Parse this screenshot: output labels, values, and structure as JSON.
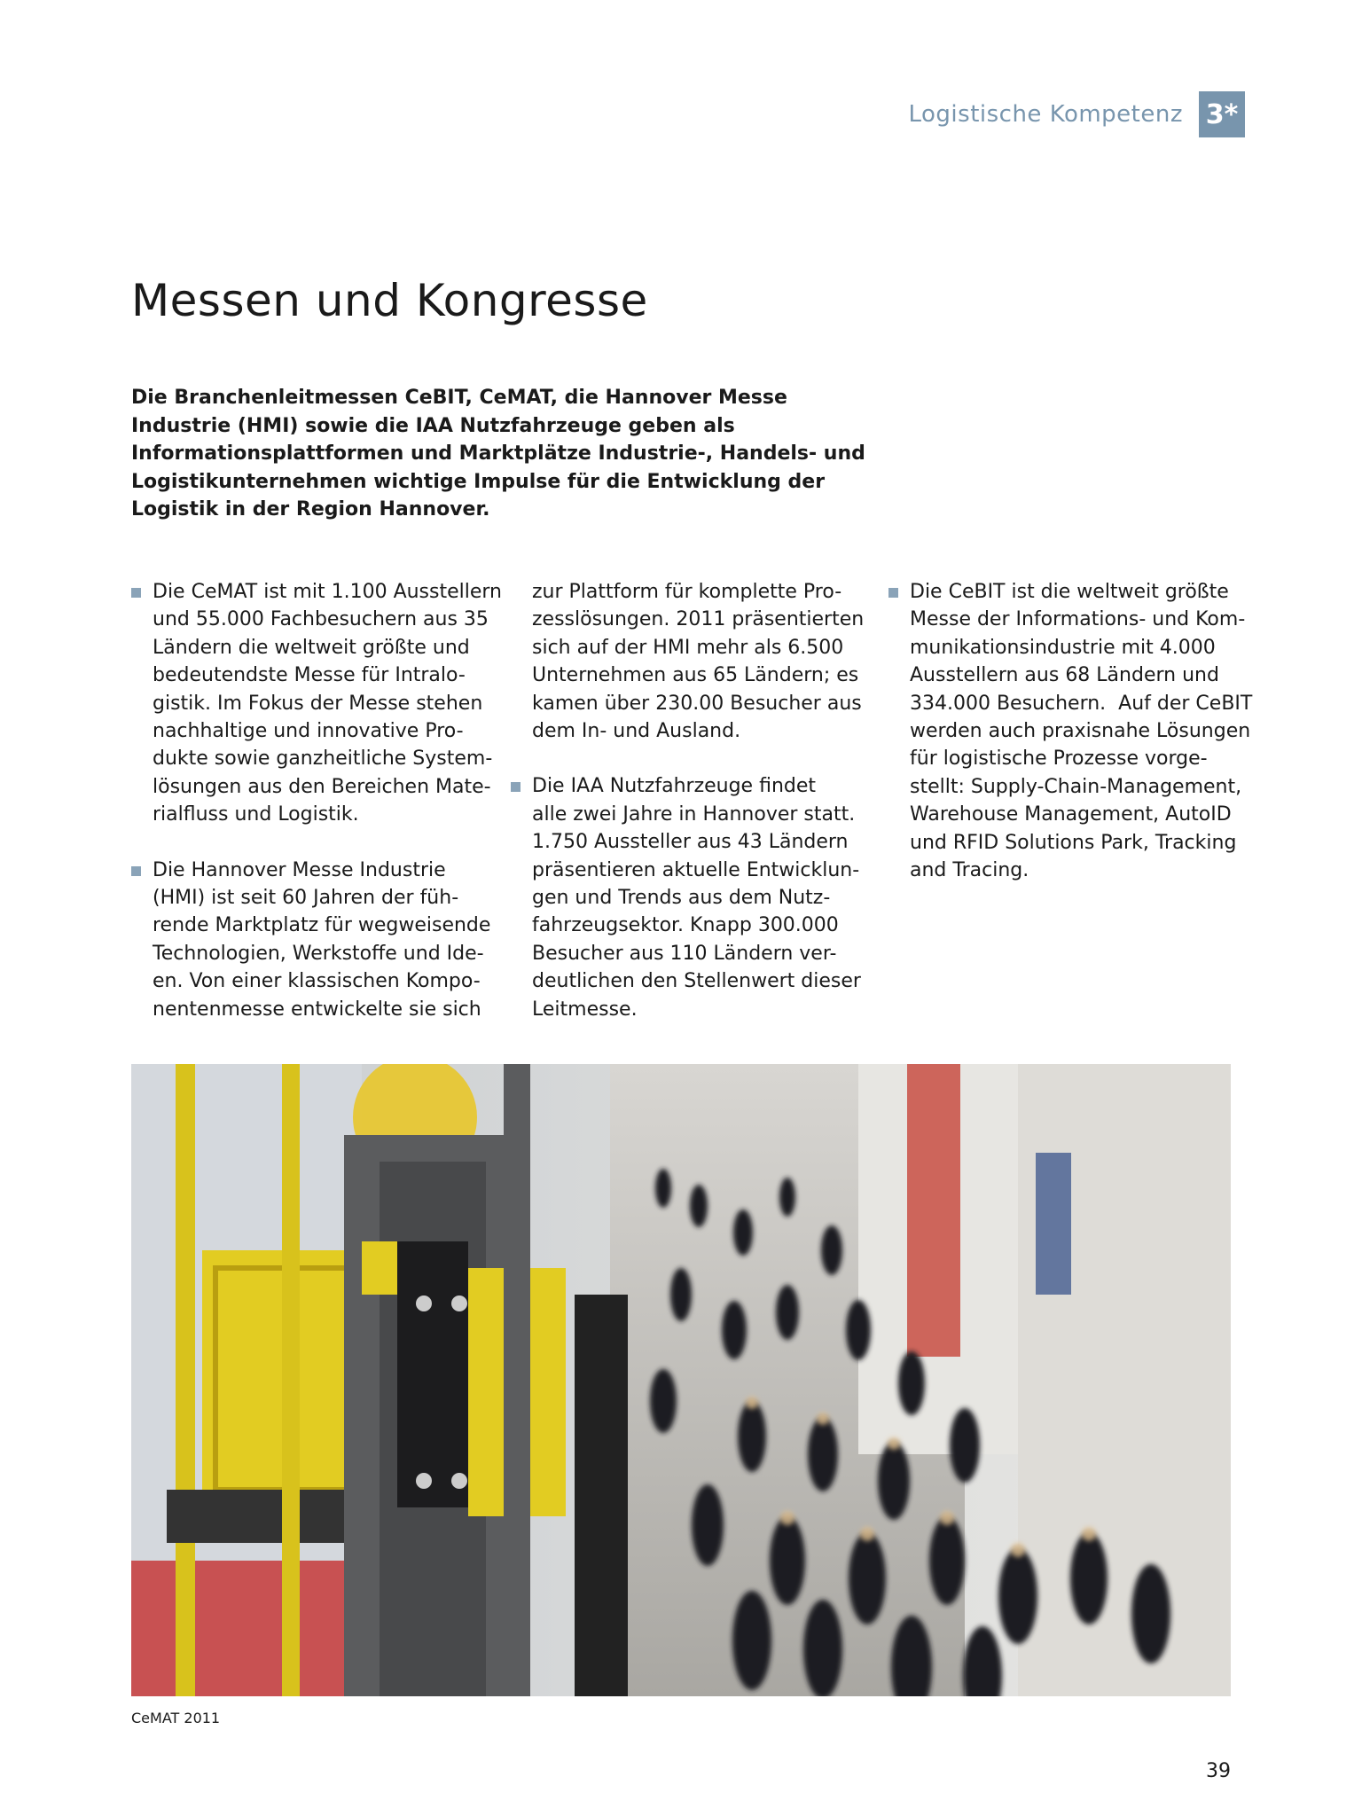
{
  "header": {
    "section_label": "Logistische Kompetenz",
    "section_number": "3*",
    "accent_color": "#7895ad"
  },
  "page_title": "Messen und Kongresse",
  "intro": "Die Branchenleitmessen CeBIT, CeMAT, die Hannover Messe Industrie (HMI) sowie die IAA Nutzfahrzeuge geben als Informationsplattformen und Marktplätze Industrie-, Handels- und Logistikunternehmen wichtige Impulse für die Entwicklung der Logistik in der Region Hannover.",
  "columns": {
    "col1": {
      "para1": "Die CeMAT ist mit 1.100 Ausstellern\nund 55.000 Fachbesuchern aus 35\nLändern die weltweit größte und\nbedeutendste Messe für Intralo-\ngistik. Im Fokus der Messe stehen\nnachhaltige und innovative Pro-\ndukte sowie ganzheitliche System-\nlösungen aus den Bereichen Mate-\nrialfluss und Logistik.",
      "para2": "Die Hannover Messe Industrie\n(HMI) ist seit 60 Jahren der füh-\nrende Marktplatz für wegweisende\nTechnologien, Werkstoffe und Ide-\nen. Von einer klassischen Kompo-\nnentenmesse entwickelte sie sich"
    },
    "col2": {
      "para1": "zur Plattform für komplette Pro-\nzesslösungen. 2011 präsentierten\nsich auf der HMI mehr als 6.500\nUnternehmen aus 65 Ländern; es\nkamen über 230.00 Besucher aus\ndem In- und Ausland.",
      "para2": "Die IAA Nutzfahrzeuge findet\nalle zwei Jahre in Hannover statt.\n1.750 Aussteller aus 43 Ländern\npräsentieren aktuelle Entwicklun-\ngen und Trends aus dem Nutz-\nfahrzeugsektor. Knapp 300.000\nBesucher aus 110 Ländern ver-\ndeutlichen den Stellenwert dieser\nLeitmesse."
    },
    "col3": {
      "para1": "Die CeBIT ist die weltweit größte\nMesse der Informations- und Kom-\nmunikationsindustrie mit 4.000\nAusstellern aus 68 Ländern und\n334.000 Besuchern.  Auf der CeBIT\nwerden auch praxisnahe Lösungen\nfür logistische Prozesse vorge-\nstellt: Supply-Chain-Management,\nWarehouse Management, AutoID\nund RFID Solutions Park, Tracking\nand Tracing."
    }
  },
  "photo_caption": "CeMAT 2011",
  "page_number": "39"
}
